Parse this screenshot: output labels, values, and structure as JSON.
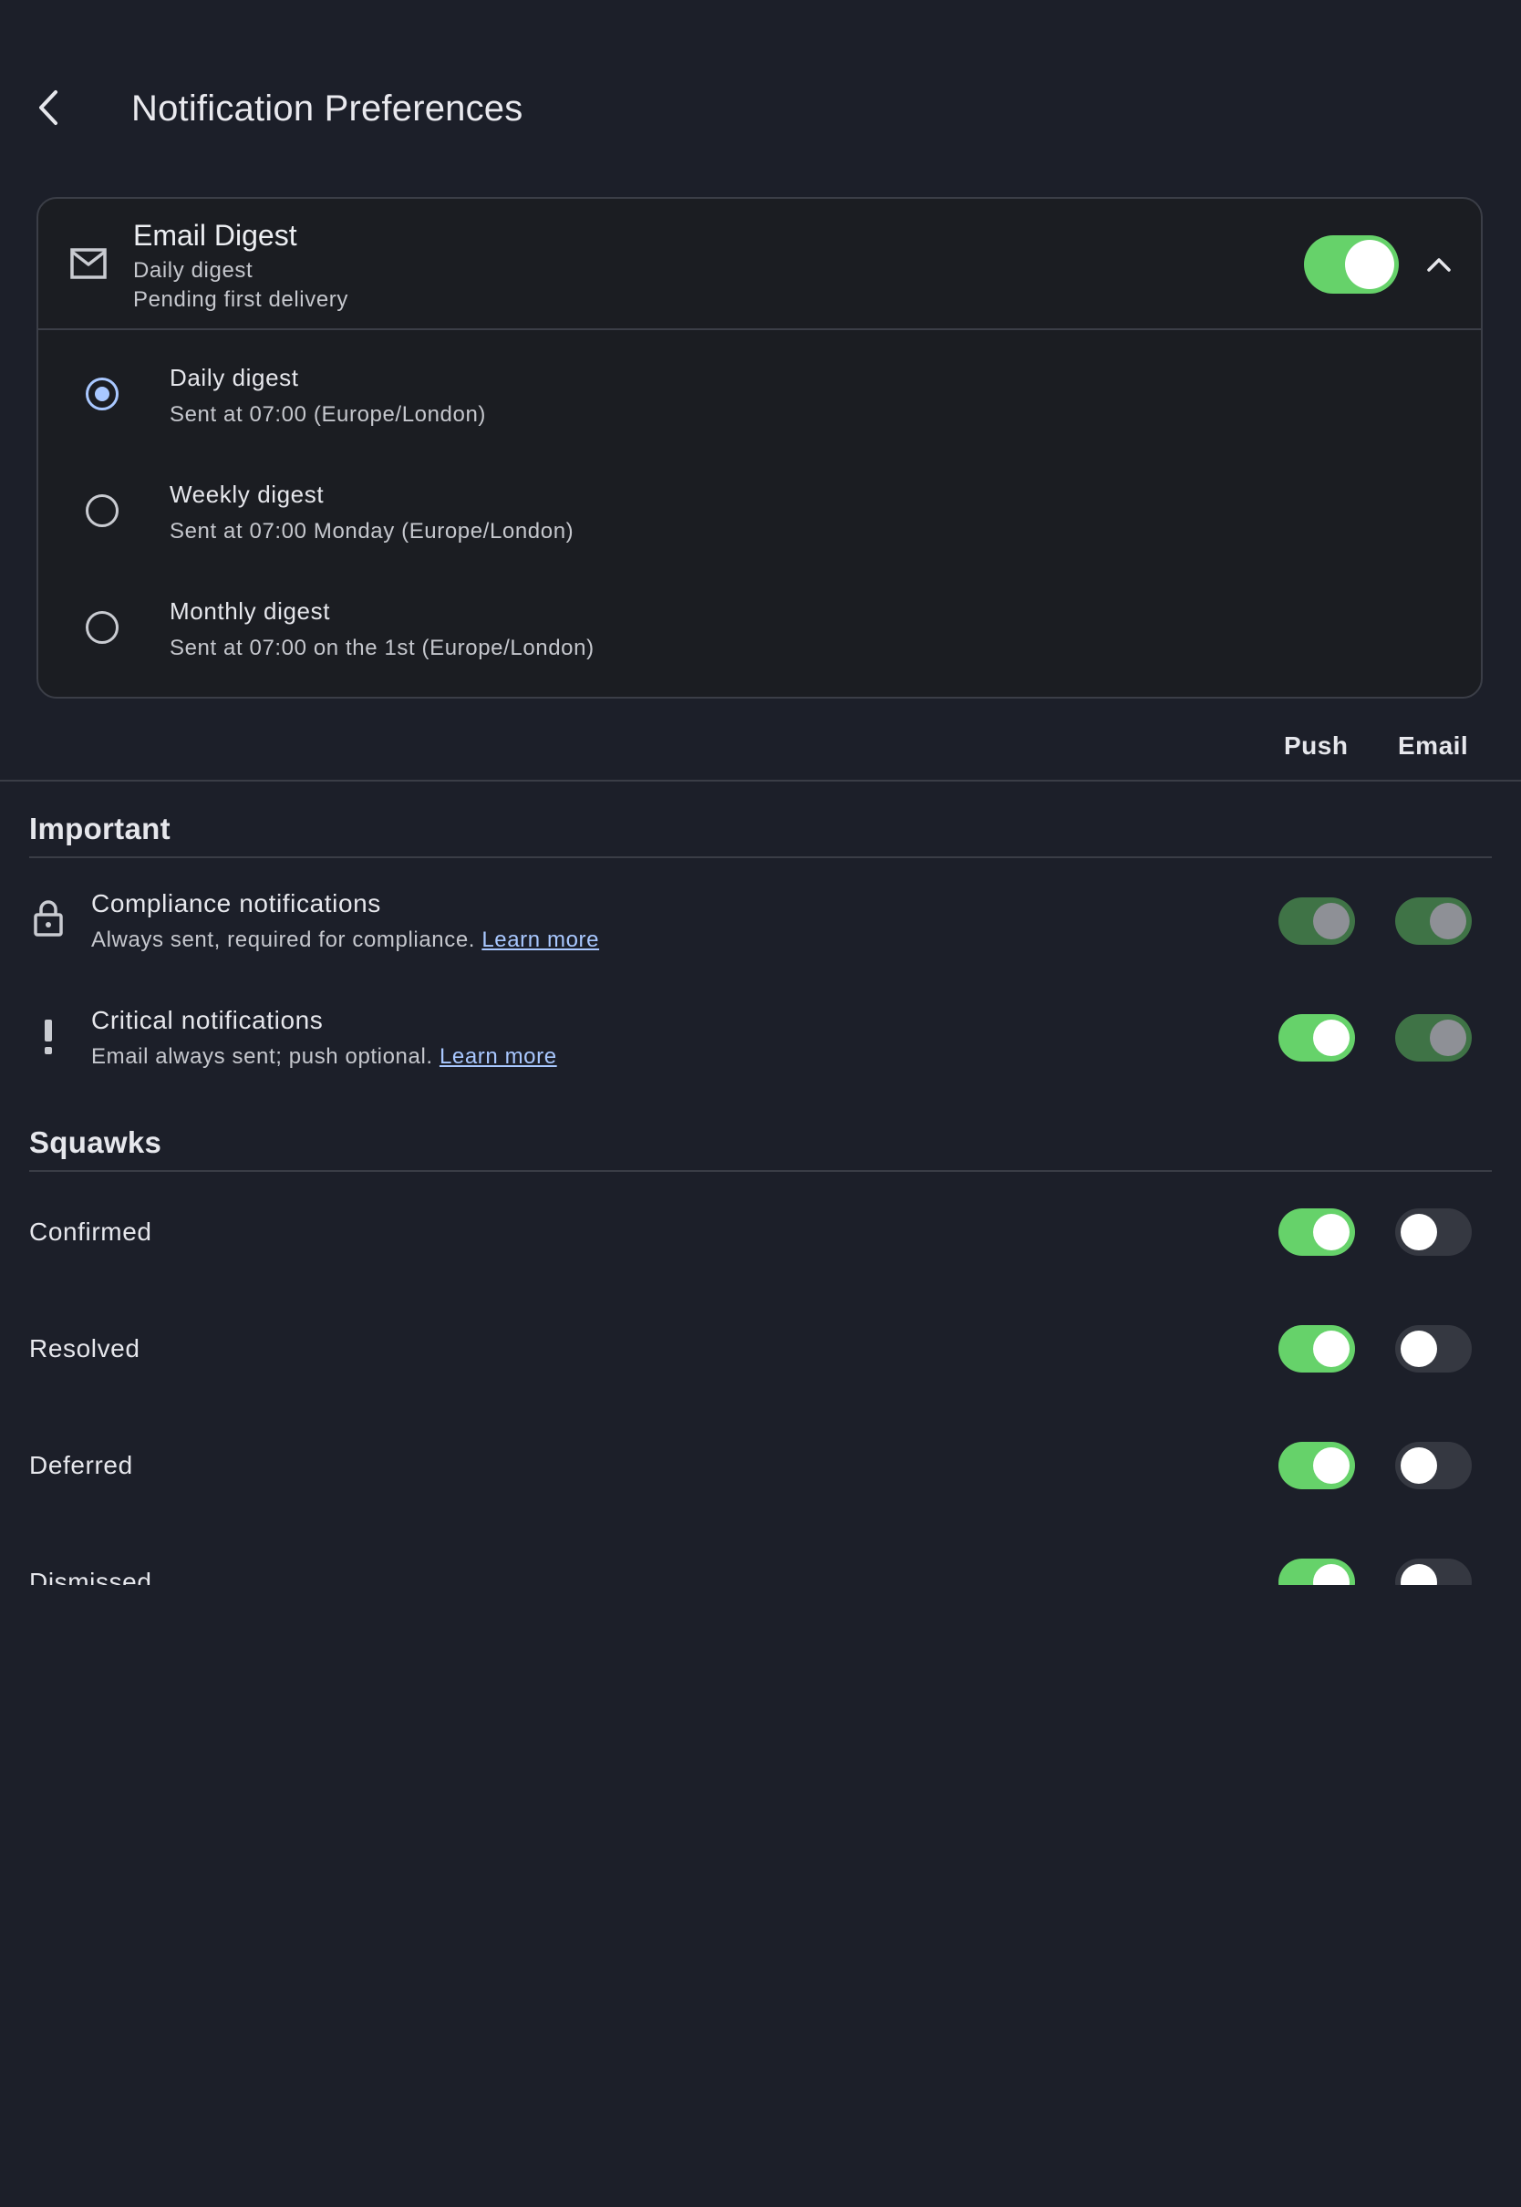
{
  "header": {
    "back_icon": "chevron-left-icon",
    "title": "Notification Preferences"
  },
  "digest": {
    "icon": "mail-icon",
    "title": "Email Digest",
    "subtitle": "Daily digest",
    "status": "Pending first delivery",
    "enabled": true,
    "expanded": true,
    "options": [
      {
        "label": "Daily digest",
        "description": "Sent at 07:00 (Europe/London)",
        "selected": true
      },
      {
        "label": "Weekly digest",
        "description": "Sent at 07:00 Monday (Europe/London)",
        "selected": false
      },
      {
        "label": "Monthly digest",
        "description": "Sent at 07:00 on the 1st (Europe/London)",
        "selected": false
      }
    ]
  },
  "columns": {
    "push": "Push",
    "email": "Email"
  },
  "important": {
    "title": "Important",
    "rows": [
      {
        "icon": "lock-icon",
        "title": "Compliance notifications",
        "description": "Always sent, required for compliance.",
        "link": "Learn more",
        "push": "locked-on",
        "email": "locked-on"
      },
      {
        "icon": "exclamation-icon",
        "title": "Critical notifications",
        "description": "Email always sent; push optional.",
        "link": "Learn more",
        "push": "on",
        "email": "locked-on"
      }
    ]
  },
  "squawks": {
    "title": "Squawks",
    "rows": [
      {
        "title": "Confirmed",
        "push": "on",
        "email": "off"
      },
      {
        "title": "Resolved",
        "push": "on",
        "email": "off"
      },
      {
        "title": "Deferred",
        "push": "on",
        "email": "off"
      },
      {
        "title": "Dismissed",
        "push": "on",
        "email": "off"
      }
    ]
  },
  "colors": {
    "background": "#1c1f29",
    "accent_on": "#66d26a",
    "locked": "#3f7346",
    "link": "#a9c8ff"
  }
}
